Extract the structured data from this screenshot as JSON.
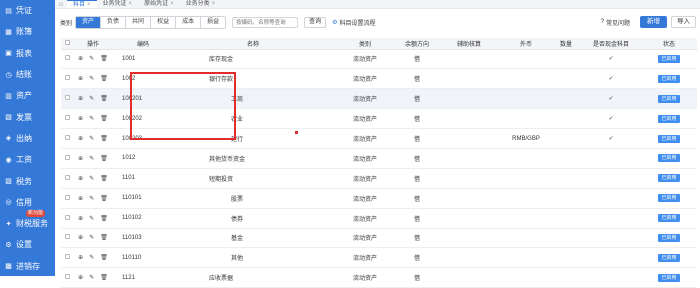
{
  "tabs": [
    {
      "label": "科目",
      "active": true
    },
    {
      "label": "业务凭证",
      "active": false
    },
    {
      "label": "原始凭证",
      "active": false
    },
    {
      "label": "业务分类",
      "active": false
    }
  ],
  "sidebar": {
    "items": [
      {
        "label": "凭证",
        "icon": "voucher-icon"
      },
      {
        "label": "账簿",
        "icon": "ledger-icon"
      },
      {
        "label": "报表",
        "icon": "report-icon"
      },
      {
        "label": "结账",
        "icon": "closing-icon"
      },
      {
        "label": "资产",
        "icon": "asset-icon"
      },
      {
        "label": "发票",
        "icon": "invoice-icon"
      },
      {
        "label": "出纳",
        "icon": "cashier-icon"
      },
      {
        "label": "工资",
        "icon": "salary-icon"
      },
      {
        "label": "税务",
        "icon": "tax-icon"
      },
      {
        "label": "信用",
        "icon": "credit-icon"
      },
      {
        "label": "财税服务",
        "icon": "service-icon",
        "badge": "新功能"
      },
      {
        "label": "设置",
        "icon": "settings-icon"
      },
      {
        "label": "进销存",
        "icon": "inventory-icon"
      }
    ]
  },
  "toolbar": {
    "category_label": "类别",
    "categories": [
      "资产",
      "负债",
      "共同",
      "权益",
      "成本",
      "损益"
    ],
    "active_category": 0,
    "search_placeholder": "按编码、名称等查询",
    "search_button": "查询",
    "flow_label": "科目设置流程",
    "help_label": "常见问题",
    "add_label": "新增",
    "import_label": "导入"
  },
  "table": {
    "headers": {
      "ops": "操作",
      "code": "编码",
      "name": "名称",
      "type": "类别",
      "direction": "余额方向",
      "aux": "辅助核算",
      "currency": "外币",
      "qty": "数量",
      "cash": "是否现金科目",
      "status": "状态"
    },
    "rows": [
      {
        "code": "1001",
        "name": "库存现金",
        "indent": "indent1",
        "type": "流动资产",
        "direction": "借",
        "currency": "",
        "cash": "✓",
        "status": "已启用"
      },
      {
        "code": "1002",
        "name": "银行存款",
        "indent": "indent1",
        "type": "流动资产",
        "direction": "借",
        "currency": "",
        "cash": "✓",
        "status": "已启用"
      },
      {
        "code": "100201",
        "name": "工商",
        "indent": "indent2",
        "type": "流动资产",
        "direction": "借",
        "currency": "",
        "cash": "✓",
        "status": "已启用"
      },
      {
        "code": "100202",
        "name": "农业",
        "indent": "indent2",
        "type": "流动资产",
        "direction": "借",
        "currency": "",
        "cash": "✓",
        "status": "已启用"
      },
      {
        "code": "100203",
        "name": "建行",
        "indent": "indent2",
        "type": "流动资产",
        "direction": "借",
        "currency": "RMB/GBP",
        "cash": "✓",
        "status": "已启用"
      },
      {
        "code": "1012",
        "name": "其他货币资金",
        "indent": "indent1",
        "type": "流动资产",
        "direction": "借",
        "currency": "",
        "cash": "",
        "status": "已启用"
      },
      {
        "code": "1101",
        "name": "短期投资",
        "indent": "indent1",
        "type": "流动资产",
        "direction": "借",
        "currency": "",
        "cash": "",
        "status": "已启用"
      },
      {
        "code": "110101",
        "name": "股票",
        "indent": "indent2",
        "type": "流动资产",
        "direction": "借",
        "currency": "",
        "cash": "",
        "status": "已启用"
      },
      {
        "code": "110102",
        "name": "债券",
        "indent": "indent2",
        "type": "流动资产",
        "direction": "借",
        "currency": "",
        "cash": "",
        "status": "已启用"
      },
      {
        "code": "110103",
        "name": "基金",
        "indent": "indent2",
        "type": "流动资产",
        "direction": "借",
        "currency": "",
        "cash": "",
        "status": "已启用"
      },
      {
        "code": "110110",
        "name": "其他",
        "indent": "indent2",
        "type": "流动资产",
        "direction": "借",
        "currency": "",
        "cash": "",
        "status": "已启用"
      },
      {
        "code": "1121",
        "name": "应收票据",
        "indent": "indent1",
        "type": "流动资产",
        "direction": "借",
        "currency": "",
        "cash": "",
        "status": "已启用"
      }
    ]
  },
  "colors": {
    "sidebar": "#3478d8",
    "accent": "#3f8ef0",
    "highlight": "#e22b2b"
  }
}
